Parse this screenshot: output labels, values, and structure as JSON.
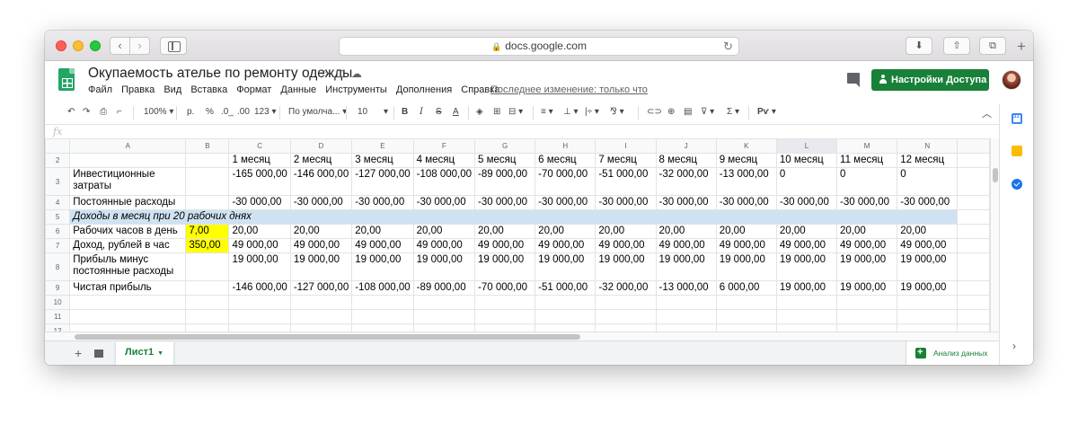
{
  "browser": {
    "url": "docs.google.com"
  },
  "doc": {
    "title": "Окупаемость ателье по ремонту одежды",
    "menu": [
      "Файл",
      "Правка",
      "Вид",
      "Вставка",
      "Формат",
      "Данные",
      "Инструменты",
      "Дополнения",
      "Справка"
    ],
    "last_edit": "Последнее изменение: только что",
    "share_label": "Настройки Доступа"
  },
  "toolbar": {
    "zoom": "100%",
    "currency": "р.",
    "percent": "%",
    "dec_less": ".0_",
    "dec_more": ".00",
    "more_formats": "123",
    "font": "По умолча...",
    "font_size": "10",
    "bold": "B",
    "italic": "I",
    "strike": "S",
    "text_color": "A",
    "sum": "Σ",
    "input_tools": "Рѵ"
  },
  "formula_bar": {
    "fx": "fx"
  },
  "sheet": {
    "columns": [
      "A",
      "B",
      "C",
      "D",
      "E",
      "F",
      "G",
      "H",
      "I",
      "J",
      "K",
      "L",
      "M",
      "N"
    ],
    "rows": [
      {
        "n": "2",
        "cells": [
          "",
          "",
          "1 месяц",
          "2 месяц",
          "3 месяц",
          "4 месяц",
          "5 месяц",
          "6 месяц",
          "7 месяц",
          "8 месяц",
          "9 месяц",
          "10 месяц",
          "11 месяц",
          "12 месяц"
        ]
      },
      {
        "n": "3",
        "cells": [
          "Инвестиционные затраты",
          "",
          "-165 000,00",
          "-146 000,00",
          "-127 000,00",
          "-108 000,00",
          "-89 000,00",
          "-70 000,00",
          "-51 000,00",
          "-32 000,00",
          "-13 000,00",
          "0",
          "0",
          "0"
        ]
      },
      {
        "n": "4",
        "cells": [
          "Постоянные расходы",
          "",
          "-30 000,00",
          "-30 000,00",
          "-30 000,00",
          "-30 000,00",
          "-30 000,00",
          "-30 000,00",
          "-30 000,00",
          "-30 000,00",
          "-30 000,00",
          "-30 000,00",
          "-30 000,00",
          "-30 000,00"
        ]
      },
      {
        "n": "5",
        "band": "Доходы в месяц при 20 рабочих днях"
      },
      {
        "n": "6",
        "cells": [
          "Рабочих часов в день",
          "7,00",
          "20,00",
          "20,00",
          "20,00",
          "20,00",
          "20,00",
          "20,00",
          "20,00",
          "20,00",
          "20,00",
          "20,00",
          "20,00",
          "20,00"
        ]
      },
      {
        "n": "7",
        "cells": [
          "Доход, рублей в час",
          "350,00",
          "49 000,00",
          "49 000,00",
          "49 000,00",
          "49 000,00",
          "49 000,00",
          "49 000,00",
          "49 000,00",
          "49 000,00",
          "49 000,00",
          "49 000,00",
          "49 000,00",
          "49 000,00"
        ]
      },
      {
        "n": "8",
        "cells": [
          "Прибыль минус постоянные расходы",
          "",
          "19 000,00",
          "19 000,00",
          "19 000,00",
          "19 000,00",
          "19 000,00",
          "19 000,00",
          "19 000,00",
          "19 000,00",
          "19 000,00",
          "19 000,00",
          "19 000,00",
          "19 000,00"
        ]
      },
      {
        "n": "9",
        "cells": [
          "Чистая прибыль",
          "",
          "-146 000,00",
          "-127 000,00",
          "-108 000,00",
          "-89 000,00",
          "-70 000,00",
          "-51 000,00",
          "-32 000,00",
          "-13 000,00",
          "6 000,00",
          "19 000,00",
          "19 000,00",
          "19 000,00"
        ]
      },
      {
        "n": "10",
        "cells": [
          "",
          "",
          "",
          "",
          "",
          "",
          "",
          "",
          "",
          "",
          "",
          "",
          "",
          ""
        ]
      },
      {
        "n": "11",
        "cells": [
          "",
          "",
          "",
          "",
          "",
          "",
          "",
          "",
          "",
          "",
          "",
          "",
          "",
          ""
        ]
      },
      {
        "n": "12",
        "cells": [
          "",
          "",
          "",
          "",
          "",
          "",
          "",
          "",
          "",
          "",
          "",
          "",
          "",
          ""
        ]
      }
    ],
    "highlight_color": "#ffff00",
    "band_color": "#cfe2f3"
  },
  "bottom": {
    "sheet_tab": "Лист1",
    "explore": "Анализ данных"
  },
  "colors": {
    "brand": "#188038"
  }
}
